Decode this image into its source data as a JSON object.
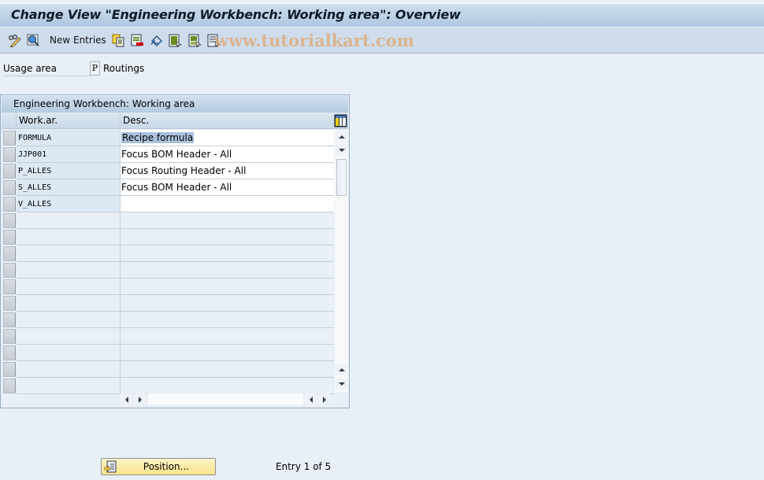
{
  "window": {
    "title": "Change View \"Engineering Workbench: Working area\": Overview"
  },
  "toolbar": {
    "items": [
      {
        "name": "display-change-icon",
        "label": ""
      },
      {
        "name": "details-icon",
        "label": ""
      },
      {
        "name": "new-entries-button",
        "label": "New Entries"
      },
      {
        "name": "copy-as-icon",
        "label": ""
      },
      {
        "name": "delete-icon",
        "label": ""
      },
      {
        "name": "undo-change-icon",
        "label": ""
      },
      {
        "name": "select-all-icon",
        "label": ""
      },
      {
        "name": "select-block-icon",
        "label": ""
      },
      {
        "name": "deselect-all-icon",
        "label": ""
      }
    ],
    "watermark": "www.tutorialkart.com"
  },
  "usage_area": {
    "label": "Usage area",
    "value": "P",
    "description": "Routings"
  },
  "table": {
    "title": "Engineering Workbench: Working area",
    "columns": [
      "Work.ar.",
      "Desc."
    ],
    "rows": [
      {
        "work_area": "FORMULA",
        "desc": "Recipe formula",
        "selected_text": true
      },
      {
        "work_area": "JJP001",
        "desc": "Focus BOM Header - All"
      },
      {
        "work_area": "P_ALLES",
        "desc": "Focus Routing Header - All"
      },
      {
        "work_area": "S_ALLES",
        "desc": "Focus BOM Header - All"
      },
      {
        "work_area": "V_ALLES",
        "desc": ""
      }
    ],
    "empty_rows": 11
  },
  "footer": {
    "position_button": "Position...",
    "entry_info": "Entry 1 of 5"
  },
  "colors": {
    "title_bar": "#afc7df",
    "toolbar": "#cedceb",
    "background": "#e9eff6",
    "key_cell": "#dce8f4",
    "selection": "#a9c2dc",
    "button_yellow": "#fbe48a"
  }
}
